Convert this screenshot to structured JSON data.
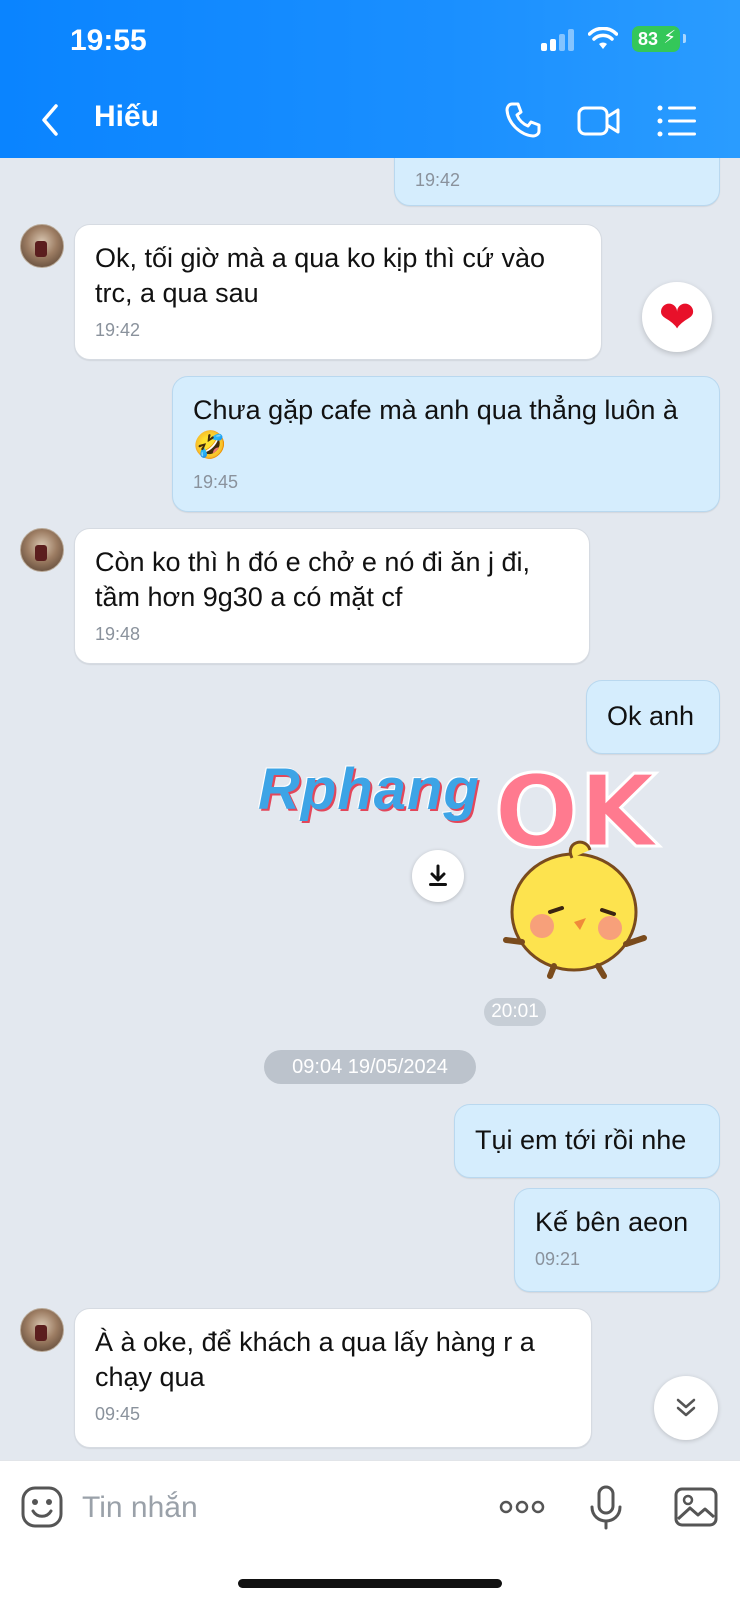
{
  "status_bar": {
    "time": "19:55",
    "battery": "83"
  },
  "header": {
    "contact_name": "Hiếu"
  },
  "messages": [
    {
      "dir": "out",
      "time": "19:42"
    },
    {
      "dir": "in",
      "text": "Ok, tối giờ mà a qua ko kịp thì cứ vào trc, a qua sau",
      "time": "19:42",
      "reaction": "❤"
    },
    {
      "dir": "out",
      "text": "Chưa gặp cafe mà anh qua thẳng luôn à 🤣",
      "time": "19:45"
    },
    {
      "dir": "in",
      "text": "Còn ko thì h đó e chở e nó đi ăn j đi, tầm hơn 9g30 a có mặt cf",
      "time": "19:48"
    },
    {
      "dir": "out",
      "text": "Ok anh"
    },
    {
      "dir": "out",
      "text": "Tụi em tới rồi nhe"
    },
    {
      "dir": "out",
      "text": "Kế bên aeon",
      "time": "09:21"
    },
    {
      "dir": "in",
      "text": "À à oke, để khách a qua lấy hàng r a chạy qua",
      "time": "09:45"
    }
  ],
  "sticker": {
    "text": "OK",
    "time": "20:01"
  },
  "watermark": "Rphang",
  "date_divider": "09:04 19/05/2024",
  "input": {
    "placeholder": "Tin nhắn"
  },
  "colors": {
    "header": "#0a84ff",
    "outgoing_bubble": "#d5edfd",
    "incoming_bubble": "#ffffff",
    "chat_bg": "#e3e8ef"
  }
}
